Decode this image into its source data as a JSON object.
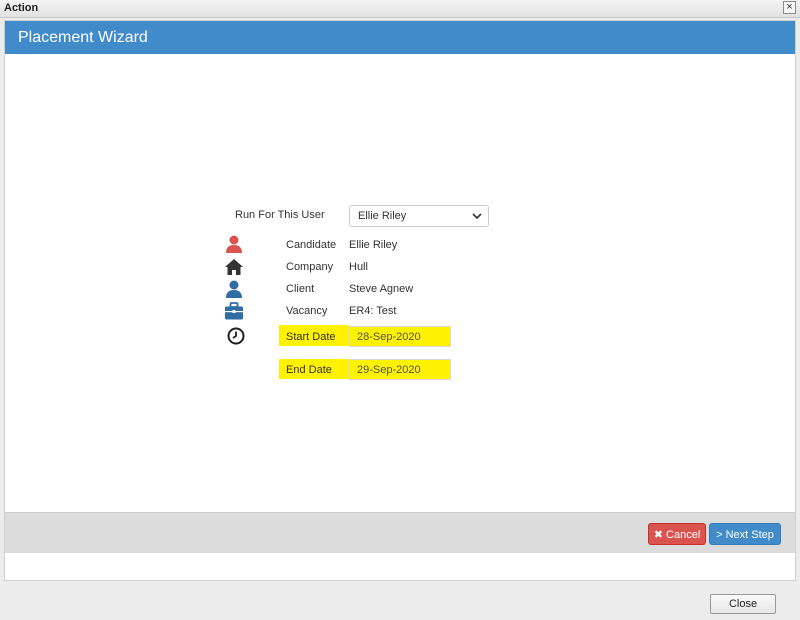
{
  "window": {
    "title": "Action",
    "close_glyph": "×"
  },
  "header": {
    "title": "Placement Wizard"
  },
  "form": {
    "run_for_user_label": "Run For This User",
    "run_for_user_value": "Ellie Riley",
    "rows": [
      {
        "label": "Candidate",
        "value": "Ellie Riley",
        "icon": "user-icon",
        "icon_color": "#d9534f"
      },
      {
        "label": "Company",
        "value": "Hull",
        "icon": "home-icon",
        "icon_color": "#333333"
      },
      {
        "label": "Client",
        "value": "Steve Agnew",
        "icon": "user-icon",
        "icon_color": "#2f6ea5"
      },
      {
        "label": "Vacancy",
        "value": "ER4: Test",
        "icon": "briefcase-icon",
        "icon_color": "#2f6ea5"
      }
    ],
    "start_date_label": "Start Date",
    "start_date_value": "28-Sep-2020",
    "end_date_label": "End Date",
    "end_date_value": "29-Sep-2020",
    "highlight_color": "#fff200"
  },
  "actions": {
    "cancel_label": "Cancel",
    "cancel_icon": "✖",
    "next_label": "> Next Step"
  },
  "footer": {
    "close_label": "Close"
  },
  "colors": {
    "header": "#428bca",
    "cancel": "#d9534f",
    "next": "#428bca"
  }
}
